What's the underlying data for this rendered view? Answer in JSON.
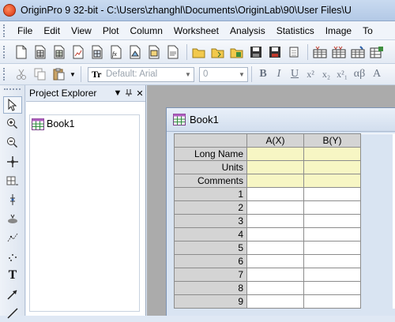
{
  "window": {
    "title": "OriginPro 9 32-bit - C:\\Users\\zhanghl\\Documents\\OriginLab\\90\\User Files\\U"
  },
  "menu": [
    "File",
    "Edit",
    "View",
    "Plot",
    "Column",
    "Worksheet",
    "Analysis",
    "Statistics",
    "Image",
    "To"
  ],
  "format_toolbar": {
    "font_value": "Default: Arial",
    "size_value": "0",
    "bold": "B",
    "italic": "I",
    "underline": "U",
    "superscript": "x²",
    "subscript": "x₂",
    "supersub": "x²₁",
    "greek": "αβ",
    "enlarge": "A"
  },
  "tools": {
    "text_tool": "T"
  },
  "project_explorer": {
    "title": "Project Explorer",
    "pin": "▼",
    "dock": "₽",
    "close": "✕",
    "items": [
      {
        "label": "Book1",
        "icon": "workbook-icon"
      }
    ]
  },
  "workbook": {
    "title": "Book1",
    "columns": [
      "A(X)",
      "B(Y)"
    ],
    "meta_rows": [
      "Long Name",
      "Units",
      "Comments"
    ],
    "rows": [
      "1",
      "2",
      "3",
      "4",
      "5",
      "6",
      "7",
      "8",
      "9"
    ]
  },
  "colors": {
    "meta_row_fill": "#f7f6c4",
    "header_fill": "#d4d4d4",
    "workspace": "#ababab"
  }
}
